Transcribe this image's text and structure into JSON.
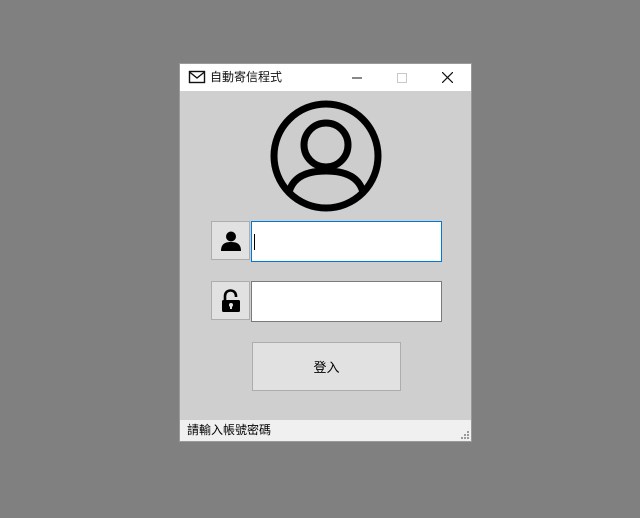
{
  "window": {
    "title": "自動寄信程式",
    "app_icon": "mail-icon",
    "controls": [
      "minimize-icon",
      "maximize-icon",
      "close-icon"
    ]
  },
  "form": {
    "profile_icon": "user-circle-icon",
    "username": {
      "icon": "user-icon",
      "value": "",
      "placeholder": ""
    },
    "password": {
      "icon": "unlock-icon",
      "value": "",
      "placeholder": ""
    },
    "login_label": "登入"
  },
  "status": {
    "text": "請輸入帳號密碼"
  },
  "colors": {
    "desktop": "#808080",
    "window_body": "#cfcfcf",
    "focus_border": "#0078d7",
    "button_face": "#e1e1e1"
  }
}
